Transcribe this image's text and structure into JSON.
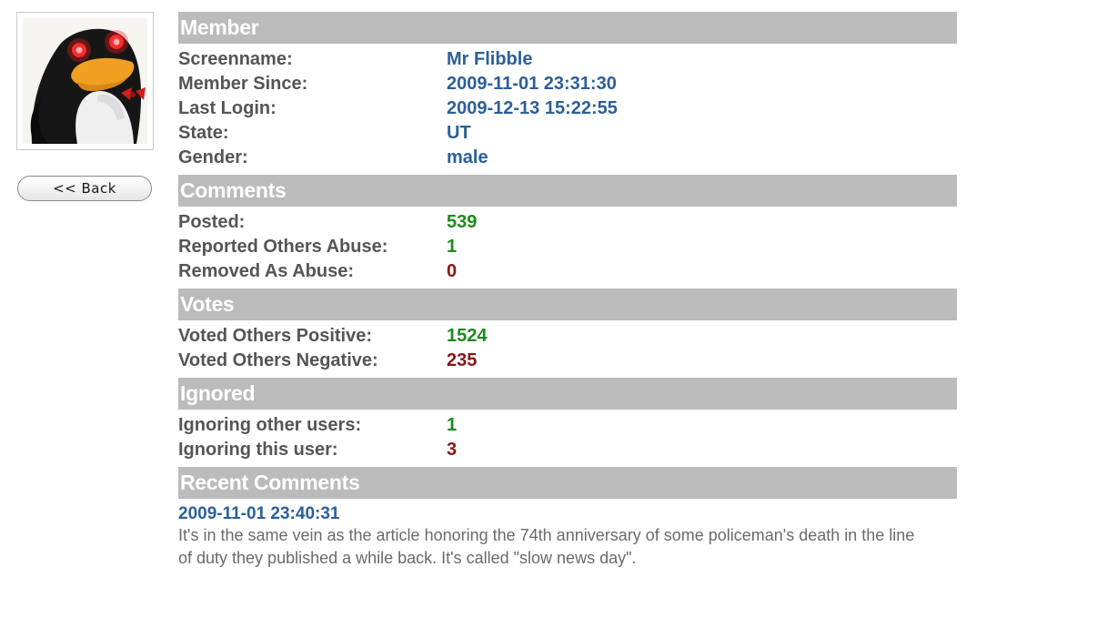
{
  "avatar": {
    "alt": "penguin-puppet-avatar"
  },
  "back_button": {
    "label": "<< Back"
  },
  "member": {
    "header": "Member",
    "rows": [
      {
        "label": "Screenname:",
        "value": "Mr Flibble"
      },
      {
        "label": "Member Since:",
        "value": "2009-11-01 23:31:30"
      },
      {
        "label": "Last Login:",
        "value": "2009-12-13 15:22:55"
      },
      {
        "label": "State:",
        "value": "UT"
      },
      {
        "label": "Gender:",
        "value": "male"
      }
    ]
  },
  "comments": {
    "header": "Comments",
    "rows": [
      {
        "label": "Posted:",
        "value": "539"
      },
      {
        "label": "Reported Others Abuse:",
        "value": "1"
      },
      {
        "label": "Removed As Abuse:",
        "value": "0"
      }
    ]
  },
  "votes": {
    "header": "Votes",
    "rows": [
      {
        "label": "Voted Others Positive:",
        "value": "1524"
      },
      {
        "label": "Voted Others Negative:",
        "value": "235"
      }
    ]
  },
  "ignored": {
    "header": "Ignored",
    "rows": [
      {
        "label": "Ignoring other users:",
        "value": "1"
      },
      {
        "label": "Ignoring this user:",
        "value": "3"
      }
    ]
  },
  "recent_comments": {
    "header": "Recent Comments",
    "items": [
      {
        "date": "2009-11-01 23:40:31",
        "text": "It's in the same vein as the article honoring the 74th anniversary of some policeman's death in the line of duty they published a while back. It's called \"slow news day\"."
      }
    ]
  },
  "colors": {
    "header_bg": "#bbbbbb",
    "label": "#555555",
    "value_blue": "#2b5f99",
    "value_green": "#1e8a1e",
    "value_red": "#8a1515"
  }
}
